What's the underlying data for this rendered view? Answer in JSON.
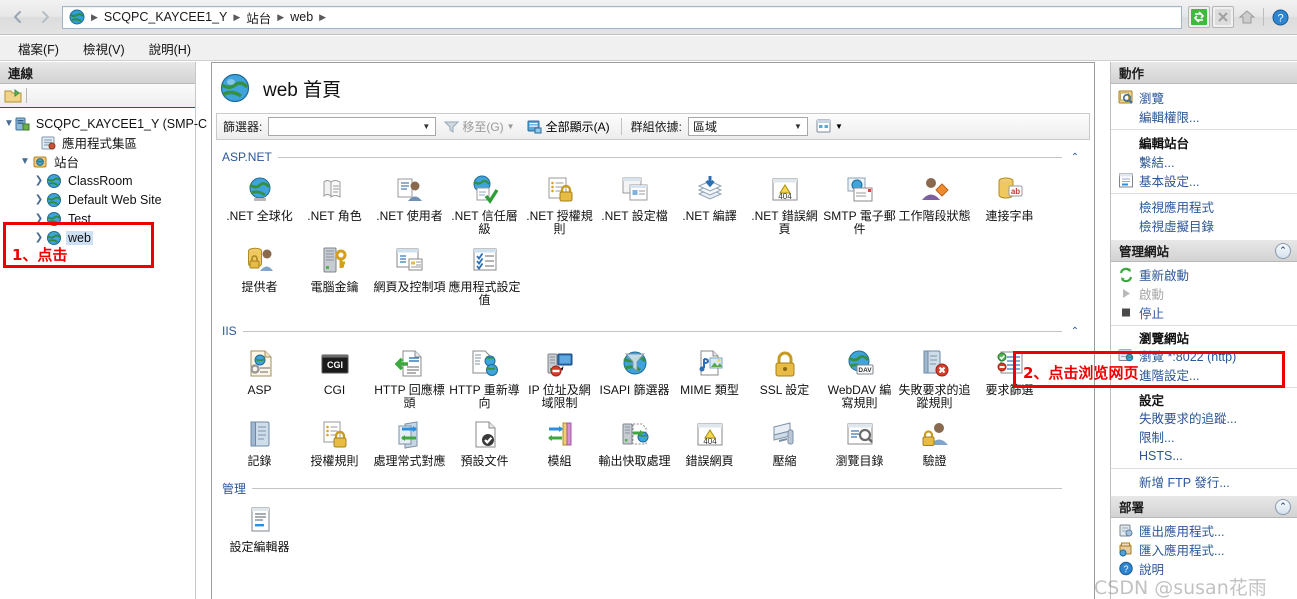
{
  "window": {
    "breadcrumb": [
      "SCQPC_KAYCEE1_Y",
      "站台",
      "web"
    ],
    "nav_back": "◀",
    "nav_forward": "▶",
    "tools": [
      "refresh-icon",
      "stop-icon",
      "home-icon",
      "help-icon"
    ]
  },
  "menubar": {
    "items": [
      "檔案(F)",
      "檢視(V)",
      "說明(H)"
    ]
  },
  "connections": {
    "title": "連線",
    "tree": [
      {
        "label": "SCQPC_KAYCEE1_Y (SMP-C",
        "indent": 0,
        "expander": "▼",
        "icon": "server-icon",
        "selected": false
      },
      {
        "label": "應用程式集區",
        "indent": 1,
        "expander": "",
        "icon": "app-pools-icon",
        "selected": false
      },
      {
        "label": "站台",
        "indent": 1,
        "expander": "▼",
        "icon": "sites-icon",
        "selected": false
      },
      {
        "label": "ClassRoom",
        "indent": 2,
        "expander": "▶",
        "icon": "site-icon",
        "selected": false
      },
      {
        "label": "Default Web Site",
        "indent": 2,
        "expander": "▶",
        "icon": "site-icon",
        "selected": false
      },
      {
        "label": "Test",
        "indent": 2,
        "expander": "▶",
        "icon": "site-icon",
        "selected": false
      },
      {
        "label": "web",
        "indent": 2,
        "expander": "▶",
        "icon": "site-icon",
        "selected": true
      }
    ]
  },
  "center": {
    "page_title": "web 首頁",
    "filter": {
      "label": "篩選器:",
      "value": "",
      "goto_label": "移至(G)",
      "showall_label": "全部顯示(A)",
      "groupby_label": "群組依據:",
      "groupby_value": "區域"
    },
    "groups": [
      {
        "name": "ASP.NET",
        "chevron": "⌃",
        "tiles": [
          {
            "label": ".NET 全球化",
            "icon": "net-globalization-icon"
          },
          {
            "label": ".NET 角色",
            "icon": "net-roles-icon"
          },
          {
            "label": ".NET 使用者",
            "icon": "net-users-icon"
          },
          {
            "label": ".NET 信任層級",
            "icon": "net-trust-levels-icon"
          },
          {
            "label": ".NET 授權規則",
            "icon": "net-authorization-rules-icon"
          },
          {
            "label": ".NET 設定檔",
            "icon": "net-profile-icon"
          },
          {
            "label": ".NET 編譯",
            "icon": "net-compilation-icon"
          },
          {
            "label": ".NET 錯誤網頁",
            "icon": "net-error-pages-icon"
          },
          {
            "label": "SMTP 電子郵件",
            "icon": "smtp-email-icon"
          },
          {
            "label": "工作階段狀態",
            "icon": "session-state-icon"
          },
          {
            "label": "連接字串",
            "icon": "connection-strings-icon"
          },
          {
            "label": "提供者",
            "icon": "providers-icon"
          },
          {
            "label": "電腦金鑰",
            "icon": "machine-key-icon"
          },
          {
            "label": "網頁及控制項",
            "icon": "pages-and-controls-icon"
          },
          {
            "label": "應用程式設定值",
            "icon": "application-settings-icon"
          }
        ]
      },
      {
        "name": "IIS",
        "chevron": "⌃",
        "tiles": [
          {
            "label": "ASP",
            "icon": "asp-icon"
          },
          {
            "label": "CGI",
            "icon": "cgi-icon"
          },
          {
            "label": "HTTP 回應標頭",
            "icon": "http-response-headers-icon"
          },
          {
            "label": "HTTP 重新導向",
            "icon": "http-redirect-icon"
          },
          {
            "label": "IP 位址及網域限制",
            "icon": "ip-address-domain-restrictions-icon"
          },
          {
            "label": "ISAPI 篩選器",
            "icon": "isapi-filters-icon"
          },
          {
            "label": "MIME 類型",
            "icon": "mime-types-icon"
          },
          {
            "label": "SSL 設定",
            "icon": "ssl-settings-icon"
          },
          {
            "label": "WebDAV 編寫規則",
            "icon": "webdav-authoring-rules-icon"
          },
          {
            "label": "失敗要求的追蹤規則",
            "icon": "failed-request-tracing-rules-icon"
          },
          {
            "label": "要求篩選",
            "icon": "request-filtering-icon"
          },
          {
            "label": "記錄",
            "icon": "logging-icon"
          },
          {
            "label": "授權規則",
            "icon": "authorization-rules-icon"
          },
          {
            "label": "處理常式對應",
            "icon": "handler-mappings-icon"
          },
          {
            "label": "預設文件",
            "icon": "default-document-icon"
          },
          {
            "label": "模組",
            "icon": "modules-icon"
          },
          {
            "label": "輸出快取處理",
            "icon": "output-caching-icon"
          },
          {
            "label": "錯誤網頁",
            "icon": "error-pages-icon"
          },
          {
            "label": "壓縮",
            "icon": "compression-icon"
          },
          {
            "label": "瀏覽目錄",
            "icon": "directory-browsing-icon"
          },
          {
            "label": "驗證",
            "icon": "authentication-icon"
          }
        ]
      },
      {
        "name": "管理",
        "chevron": "",
        "tiles": [
          {
            "label": "設定編輯器",
            "icon": "configuration-editor-icon"
          }
        ]
      }
    ]
  },
  "actions": {
    "title": "動作",
    "groups": [
      {
        "header": null,
        "rows": [
          {
            "label": "瀏覽",
            "icon": "browse-icon",
            "style": "link"
          },
          {
            "label": "編輯權限...",
            "icon": null,
            "style": "link"
          }
        ]
      },
      {
        "header": null,
        "rows": [
          {
            "label": "編輯站台",
            "icon": null,
            "style": "bold"
          },
          {
            "label": "繫結...",
            "icon": null,
            "style": "link"
          },
          {
            "label": "基本設定...",
            "icon": "basic-settings-icon",
            "style": "link"
          }
        ]
      },
      {
        "header": null,
        "rows": [
          {
            "label": "檢視應用程式",
            "icon": null,
            "style": "link"
          },
          {
            "label": "檢視虛擬目錄",
            "icon": null,
            "style": "link"
          }
        ]
      }
    ],
    "manage_site": {
      "header": "管理網站",
      "collapse": "⌃",
      "rows": [
        {
          "label": "重新啟動",
          "icon": "restart-icon",
          "style": "link"
        },
        {
          "label": "啟動",
          "icon": "start-icon",
          "style": "disabled"
        },
        {
          "label": "停止",
          "icon": "stop-square-icon",
          "style": "link"
        }
      ],
      "browse_header": "瀏覽網站",
      "browse_rows": [
        {
          "label": "瀏覽 *:8022 (http)",
          "icon": "browse-site-icon",
          "style": "link"
        },
        {
          "label": "進階設定...",
          "icon": null,
          "style": "link"
        }
      ],
      "settings_header": "設定",
      "settings_rows": [
        {
          "label": "失敗要求的追蹤...",
          "icon": null,
          "style": "link"
        },
        {
          "label": "限制...",
          "icon": null,
          "style": "link"
        },
        {
          "label": "HSTS...",
          "icon": null,
          "style": "link"
        }
      ],
      "ftp_rows": [
        {
          "label": "新增 FTP 發行...",
          "icon": null,
          "style": "link"
        }
      ]
    },
    "deploy": {
      "header": "部署",
      "collapse": "⌃",
      "rows": [
        {
          "label": "匯出應用程式...",
          "icon": "export-app-icon",
          "style": "link"
        },
        {
          "label": "匯入應用程式...",
          "icon": "import-app-icon",
          "style": "link"
        },
        {
          "label": "說明",
          "icon": "help-blue-icon",
          "style": "link"
        }
      ]
    }
  },
  "annotations": {
    "step1_text": "1、点击",
    "step2_text": "2、点击浏览网页",
    "accent_red": "#ee0000"
  },
  "watermark": {
    "text": "CSDN @susan花雨"
  }
}
